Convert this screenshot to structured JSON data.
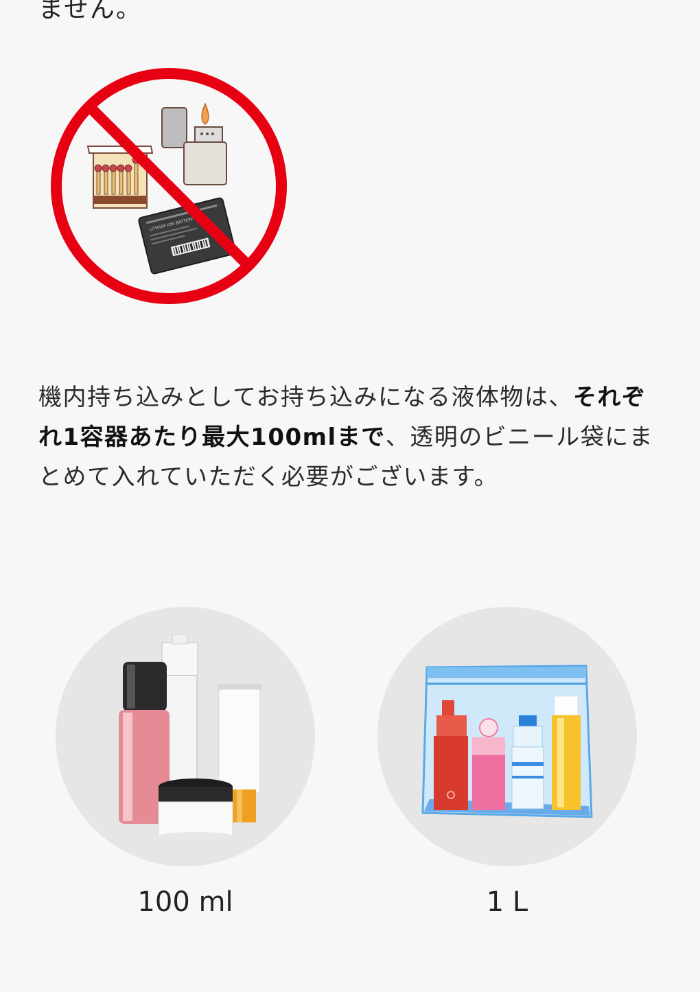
{
  "intro_tail": "ません。",
  "prohibited_image": {
    "icon": "no-fire-battery-icon",
    "battery_label": "LITHIUM ION BATTERY",
    "colors": {
      "ring": "#e60012"
    }
  },
  "liquids_paragraph": {
    "part1": "機内持ち込みとしてお持ち込みになる液体物は、",
    "bold": "それぞれ1容器あたり最大100mlまで",
    "part2": "、透明のビニール袋にまとめて入れていただく必要がございます。"
  },
  "limits": [
    {
      "icon": "cosmetics-containers-icon",
      "caption": "100 ml"
    },
    {
      "icon": "clear-plastic-bag-icon",
      "caption": "1 L"
    }
  ]
}
